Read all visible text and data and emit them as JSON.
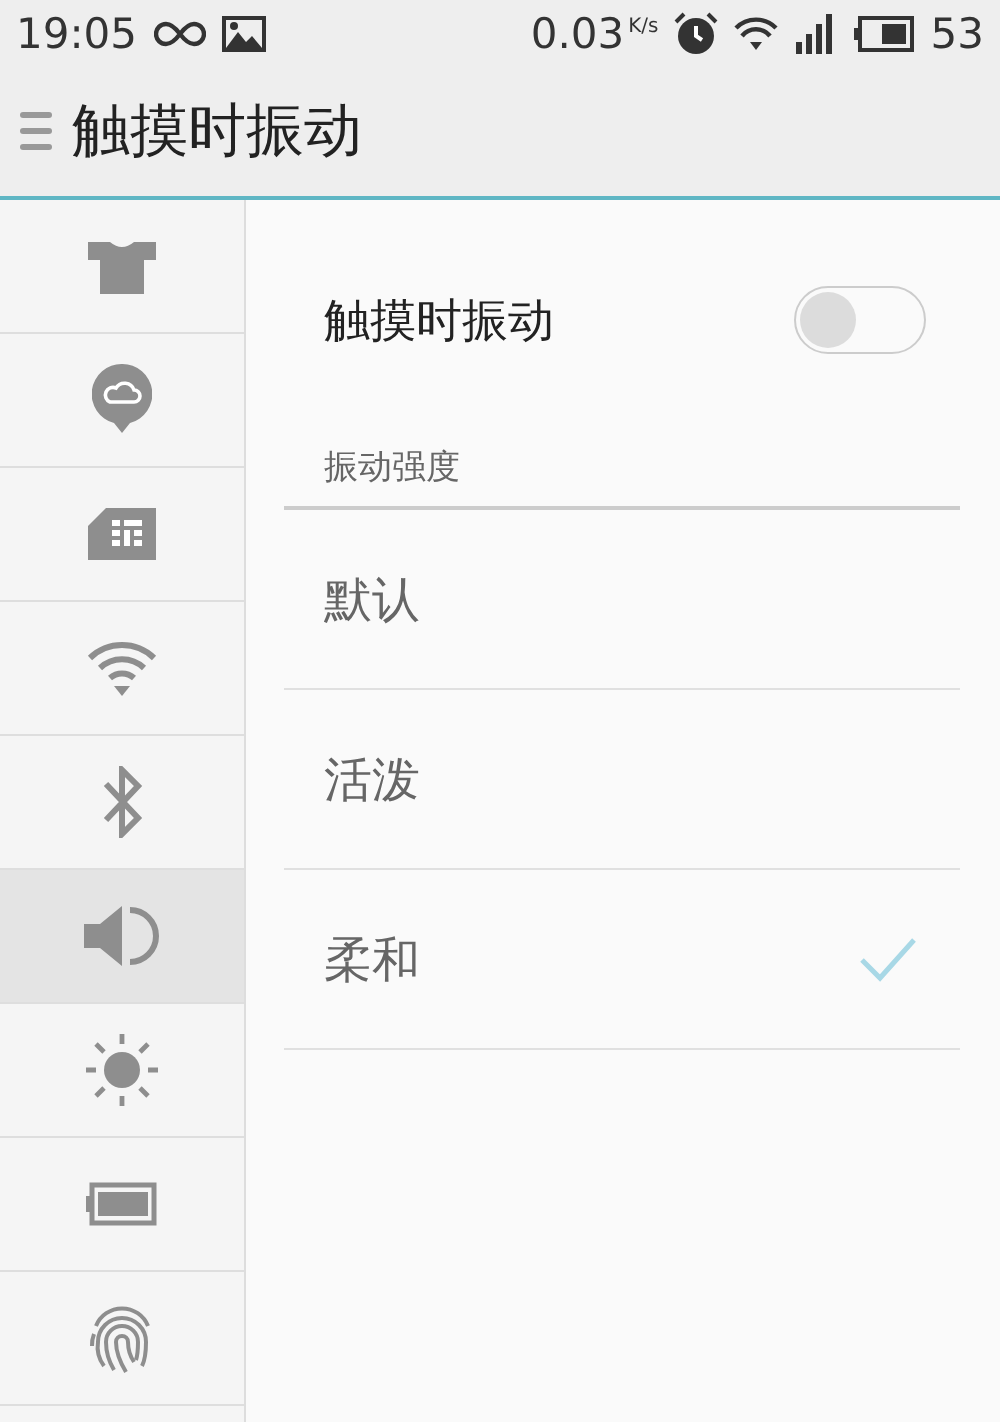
{
  "status_bar": {
    "time": "19:05",
    "net_speed": "0.03",
    "net_unit": "K/s",
    "battery": "53"
  },
  "header": {
    "title": "触摸时振动"
  },
  "sidebar": {
    "items": [
      {
        "kind": "theme",
        "selected": false
      },
      {
        "kind": "cloud",
        "selected": false
      },
      {
        "kind": "sim",
        "selected": false
      },
      {
        "kind": "wifi",
        "selected": false
      },
      {
        "kind": "bluetooth",
        "selected": false
      },
      {
        "kind": "sound",
        "selected": true
      },
      {
        "kind": "brightness",
        "selected": false
      },
      {
        "kind": "battery",
        "selected": false
      },
      {
        "kind": "fingerprint",
        "selected": false
      }
    ]
  },
  "vibration": {
    "label": "触摸时振动",
    "on": false
  },
  "intensity": {
    "section_label": "振动强度",
    "options": [
      {
        "label": "默认",
        "selected": false
      },
      {
        "label": "活泼",
        "selected": false
      },
      {
        "label": "柔和",
        "selected": true
      }
    ]
  }
}
